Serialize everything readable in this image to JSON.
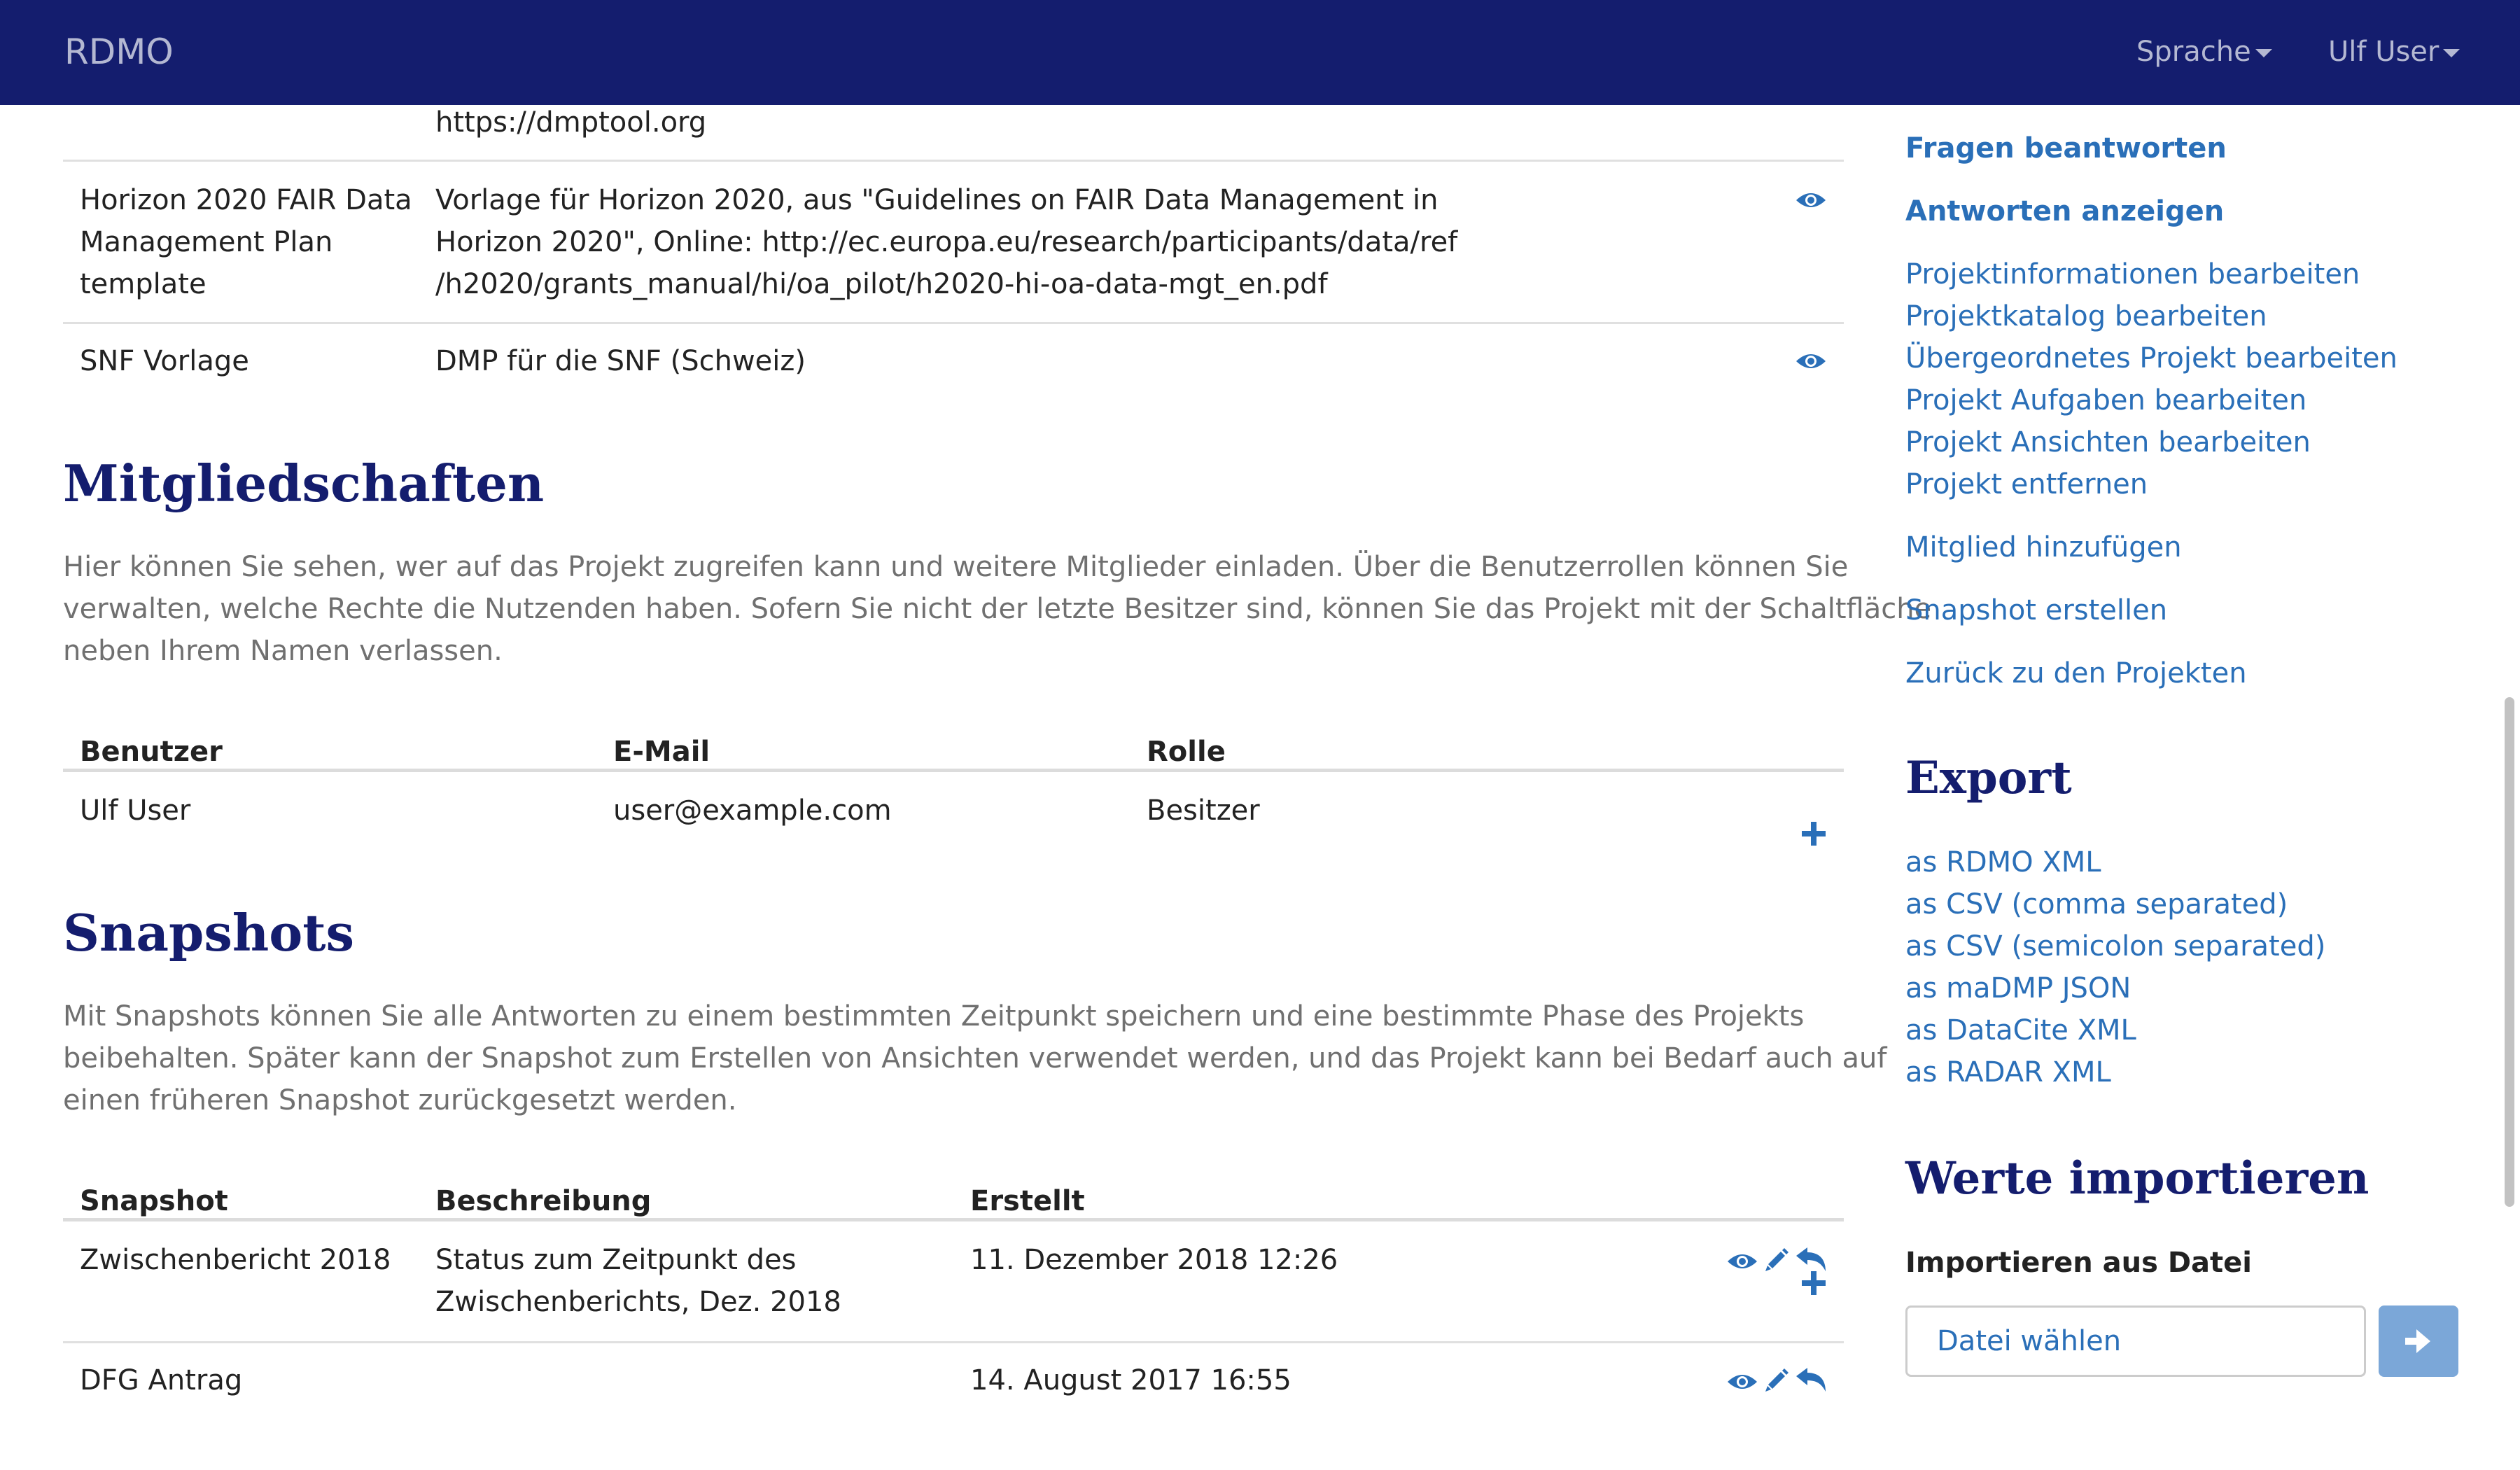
{
  "navbar": {
    "brand": "RDMO",
    "language_label": "Sprache",
    "user_label": "Ulf User"
  },
  "templates": {
    "partial_cell": "https://dmptool.org",
    "rows": [
      {
        "name_lines": [
          "Horizon 2020 FAIR Data",
          "Management Plan",
          "template"
        ],
        "description_lines": [
          "Vorlage für Horizon 2020, aus \"Guidelines on FAIR Data Management in",
          "Horizon 2020\", Online: http://ec.europa.eu/research/participants/data/ref",
          "/h2020/grants_manual/hi/oa_pilot/h2020-hi-oa-data-mgt_en.pdf"
        ]
      },
      {
        "name_lines": [
          "SNF Vorlage"
        ],
        "description_lines": [
          "DMP für die SNF (Schweiz)"
        ]
      }
    ]
  },
  "memberships": {
    "title": "Mitgliedschaften",
    "intro_lines": [
      "Hier können Sie sehen, wer auf das Projekt zugreifen kann und weitere Mitglieder einladen. Über die Benutzerrollen können Sie",
      "verwalten, welche Rechte die Nutzenden haben. Sofern Sie nicht der letzte Besitzer sind, können Sie das Projekt mit der Schaltfläche",
      "neben Ihrem Namen verlassen."
    ],
    "columns": [
      "Benutzer",
      "E-Mail",
      "Rolle"
    ],
    "rows": [
      {
        "user": "Ulf User",
        "email": "user@example.com",
        "role": "Besitzer"
      }
    ]
  },
  "snapshots": {
    "title": "Snapshots",
    "intro_lines": [
      "Mit Snapshots können Sie alle Antworten zu einem bestimmten Zeitpunkt speichern und eine bestimmte Phase des Projekts",
      "beibehalten. Später kann der Snapshot zum Erstellen von Ansichten verwendet werden, und das Projekt kann bei Bedarf auch auf",
      "einen früheren Snapshot zurückgesetzt werden."
    ],
    "columns": [
      "Snapshot",
      "Beschreibung",
      "Erstellt"
    ],
    "rows": [
      {
        "name": "Zwischenbericht 2018",
        "description_lines": [
          "Status zum Zeitpunkt des",
          "Zwischenberichts, Dez. 2018"
        ],
        "created": "11. Dezember 2018 12:26"
      },
      {
        "name": "DFG Antrag",
        "description_lines": [
          ""
        ],
        "created": "14. August 2017 16:55"
      }
    ]
  },
  "sidebar": {
    "primary_links": [
      "Fragen beantworten",
      "Antworten anzeigen"
    ],
    "edit_links": [
      "Projektinformationen bearbeiten",
      "Projektkatalog bearbeiten",
      "Übergeordnetes Projekt bearbeiten",
      "Projekt Aufgaben bearbeiten",
      "Projekt Ansichten bearbeiten",
      "Projekt entfernen"
    ],
    "add_member": "Mitglied hinzufügen",
    "create_snapshot": "Snapshot erstellen",
    "back_to_projects": "Zurück zu den Projekten",
    "export_title": "Export",
    "export_links": [
      "as RDMO XML",
      "as CSV (comma separated)",
      "as CSV (semicolon separated)",
      "as maDMP JSON",
      "as DataCite XML",
      "as RADAR XML"
    ],
    "import_title": "Werte importieren",
    "import_label": "Importieren aus Datei",
    "file_button": "Datei wählen"
  },
  "icons": {
    "view": "eye-icon",
    "edit": "pencil-icon",
    "rollback": "reply-icon",
    "add": "plus-icon",
    "submit": "arrow-right-icon",
    "dropdown": "caret-down-icon"
  },
  "colors": {
    "navbar": "#141d6e",
    "link": "#2a6fb8",
    "heading": "#141d6e",
    "submit_button": "#7ba7d8"
  }
}
